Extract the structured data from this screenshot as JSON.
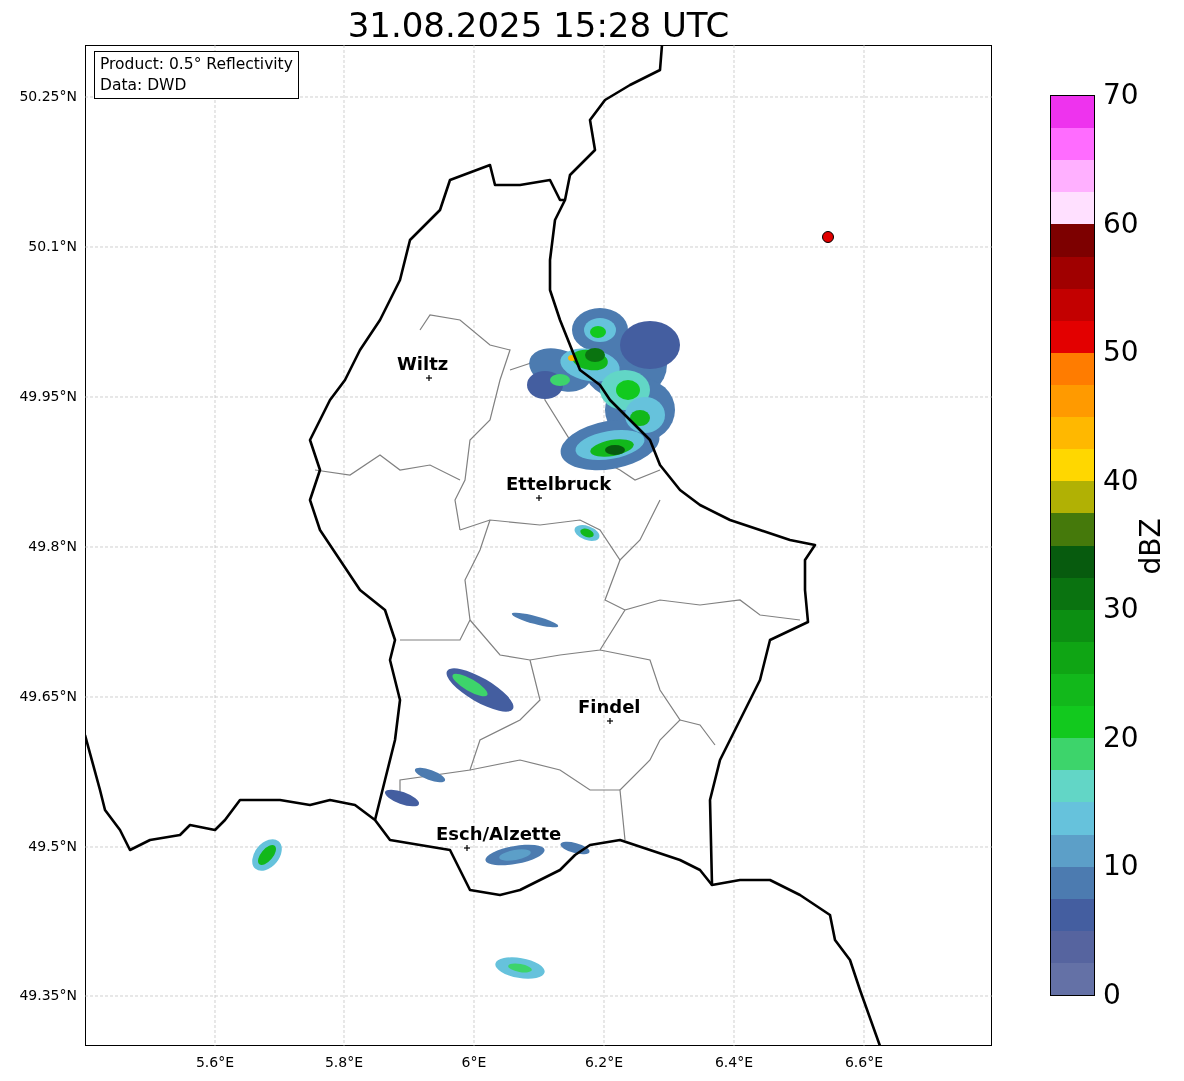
{
  "title": "31.08.2025 15:28 UTC",
  "legend": [
    "Product: 0.5° Reflectivity",
    "Data: DWD"
  ],
  "lat_labels": [
    "50.25°N",
    "50.1°N",
    "49.95°N",
    "49.8°N",
    "49.65°N",
    "49.5°N",
    "49.35°N"
  ],
  "lon_labels": [
    "5.6°E",
    "5.8°E",
    "6°E",
    "6.2°E",
    "6.4°E",
    "6.6°E"
  ],
  "cities": [
    {
      "name": "Wiltz"
    },
    {
      "name": "Ettelbruck"
    },
    {
      "name": "Findel"
    },
    {
      "name": "Esch/Alzette"
    }
  ],
  "colorbar": {
    "label": "dBZ",
    "ticks": [
      "70",
      "60",
      "50",
      "40",
      "30",
      "20",
      "10",
      "0"
    ],
    "bands": [
      {
        "color": "#ee33ee"
      },
      {
        "color": "#ff6cff"
      },
      {
        "color": "#ffb0ff"
      },
      {
        "color": "#ffe0ff"
      },
      {
        "color": "#7d0000"
      },
      {
        "color": "#a00000"
      },
      {
        "color": "#c30000"
      },
      {
        "color": "#e30000"
      },
      {
        "color": "#ff7c00"
      },
      {
        "color": "#ff9a00"
      },
      {
        "color": "#ffb800"
      },
      {
        "color": "#ffd700"
      },
      {
        "color": "#b1b104"
      },
      {
        "color": "#45790b"
      },
      {
        "color": "#075b0e"
      },
      {
        "color": "#0a7310"
      },
      {
        "color": "#0c8f12"
      },
      {
        "color": "#0fa514"
      },
      {
        "color": "#12b81b"
      },
      {
        "color": "#12c91e"
      },
      {
        "color": "#3dd46b"
      },
      {
        "color": "#62d6c6"
      },
      {
        "color": "#66c2dc"
      },
      {
        "color": "#5c9fc8"
      },
      {
        "color": "#4c7bb0"
      },
      {
        "color": "#445ea0"
      },
      {
        "color": "#56649f"
      },
      {
        "color": "#6471a6"
      }
    ]
  }
}
